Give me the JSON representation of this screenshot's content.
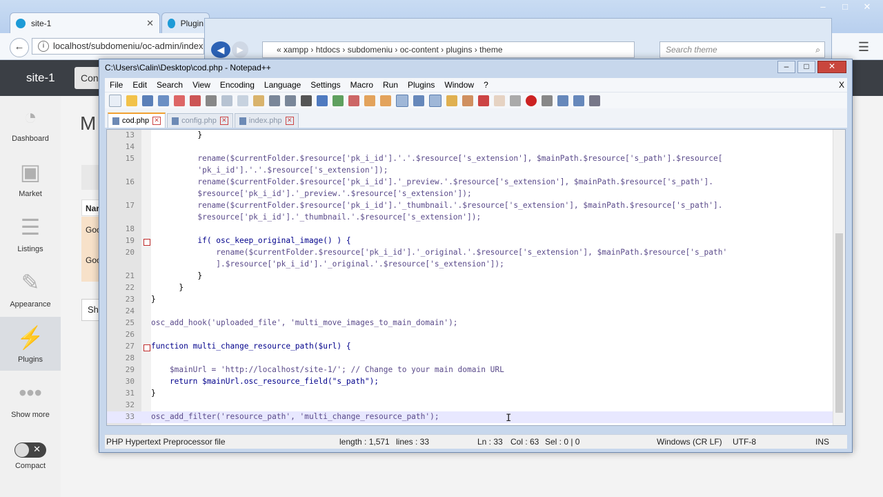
{
  "browser": {
    "tabs": [
      {
        "label": "site-1"
      },
      {
        "label": "Plugin"
      }
    ],
    "url": "localhost/subdomeniu/oc-admin/index.p",
    "window_controls": [
      "–",
      "□",
      "✕"
    ]
  },
  "explorer": {
    "path_segments": "«  xampp  ›  htdocs  ›  subdomeniu  ›  oc-content  ›  plugins  ›  theme",
    "search_placeholder": "Search theme"
  },
  "admin": {
    "site_name": "site-1",
    "sidebar": [
      {
        "label": "Dashboard",
        "icon": "speedometer-icon"
      },
      {
        "label": "Market",
        "icon": "bag-icon"
      },
      {
        "label": "Listings",
        "icon": "list-icon"
      },
      {
        "label": "Appearance",
        "icon": "brush-icon"
      },
      {
        "label": "Plugins",
        "icon": "plug-icon"
      },
      {
        "label": "Show more",
        "icon": "dots-icon"
      },
      {
        "label": "Compact",
        "icon": "toggle-icon"
      }
    ],
    "main_partial": [
      "Con",
      "M",
      "Nar",
      "Goo",
      "Goo",
      "Sh"
    ]
  },
  "npp": {
    "title": "C:\\Users\\Calin\\Desktop\\cod.php - Notepad++",
    "menu": [
      "File",
      "Edit",
      "Search",
      "View",
      "Encoding",
      "Language",
      "Settings",
      "Macro",
      "Run",
      "Plugins",
      "Window",
      "?"
    ],
    "menu_close": "X",
    "tabs": [
      {
        "label": "cod.php",
        "active": true
      },
      {
        "label": "config.php",
        "active": false
      },
      {
        "label": "index.php",
        "active": false
      }
    ],
    "lines": [
      {
        "n": "13",
        "text": "          }"
      },
      {
        "n": "14",
        "text": ""
      },
      {
        "n": "15",
        "text": "          rename($currentFolder.$resource['pk_i_id'].'.'.$resource['s_extension'], $mainPath.$resource['s_path'].$resource["
      },
      {
        "n": "",
        "text": "          'pk_i_id'].'.'.$resource['s_extension']);"
      },
      {
        "n": "16",
        "text": "          rename($currentFolder.$resource['pk_i_id'].'_preview.'.$resource['s_extension'], $mainPath.$resource['s_path']."
      },
      {
        "n": "",
        "text": "          $resource['pk_i_id'].'_preview.'.$resource['s_extension']);"
      },
      {
        "n": "17",
        "text": "          rename($currentFolder.$resource['pk_i_id'].'_thumbnail.'.$resource['s_extension'], $mainPath.$resource['s_path']."
      },
      {
        "n": "",
        "text": "          $resource['pk_i_id'].'_thumbnail.'.$resource['s_extension']);"
      },
      {
        "n": "18",
        "text": ""
      },
      {
        "n": "19",
        "text": "          if( osc_keep_original_image() ) {"
      },
      {
        "n": "20",
        "text": "              rename($currentFolder.$resource['pk_i_id'].'_original.'.$resource['s_extension'], $mainPath.$resource['s_path'"
      },
      {
        "n": "",
        "text": "              ].$resource['pk_i_id'].'_original.'.$resource['s_extension']);"
      },
      {
        "n": "21",
        "text": "          }"
      },
      {
        "n": "22",
        "text": "      }"
      },
      {
        "n": "23",
        "text": "}"
      },
      {
        "n": "24",
        "text": ""
      },
      {
        "n": "25",
        "text": "osc_add_hook('uploaded_file', 'multi_move_images_to_main_domain');"
      },
      {
        "n": "26",
        "text": ""
      },
      {
        "n": "27",
        "text": "function multi_change_resource_path($url) {"
      },
      {
        "n": "28",
        "text": ""
      },
      {
        "n": "29",
        "text": "    $mainUrl = 'http://localhost/site-1/'; // Change to your main domain URL"
      },
      {
        "n": "30",
        "text": "    return $mainUrl.osc_resource_field(\"s_path\");"
      },
      {
        "n": "31",
        "text": "}"
      },
      {
        "n": "32",
        "text": ""
      },
      {
        "n": "33",
        "text": "osc_add_filter('resource_path', 'multi_change_resource_path');"
      }
    ],
    "status": {
      "filetype": "PHP Hypertext Preprocessor file",
      "length": "length : 1,571",
      "lines": "lines : 33",
      "ln": "Ln : 33",
      "col": "Col : 63",
      "sel": "Sel : 0 | 0",
      "eol": "Windows (CR LF)",
      "encoding": "UTF-8",
      "mode": "INS"
    }
  }
}
